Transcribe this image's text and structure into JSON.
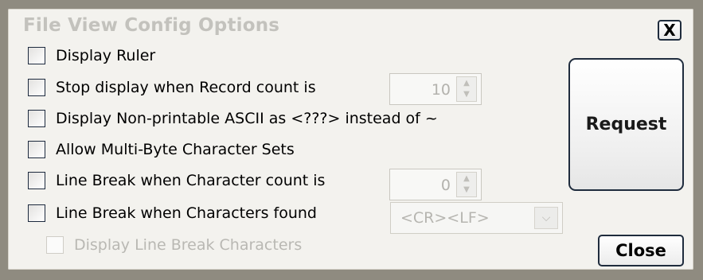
{
  "dialog": {
    "title": "File View Config Options",
    "close_x_label": "X"
  },
  "options": [
    {
      "label": "Display Ruler",
      "checked": false,
      "enabled": true
    },
    {
      "label": "Stop display when Record count is",
      "checked": false,
      "enabled": true
    },
    {
      "label": "Display Non-printable ASCII as <???> instead of ~",
      "checked": false,
      "enabled": true
    },
    {
      "label": "Allow Multi-Byte Character Sets",
      "checked": false,
      "enabled": true
    },
    {
      "label": "Line Break when Character count is",
      "checked": false,
      "enabled": true
    },
    {
      "label": "Line Break when Characters found",
      "checked": false,
      "enabled": true
    },
    {
      "label": "Display Line Break Characters",
      "checked": false,
      "enabled": false
    }
  ],
  "record_count_spinner": {
    "value": "10",
    "enabled": false
  },
  "char_count_spinner": {
    "value": "0",
    "enabled": false
  },
  "line_break_chars_dropdown": {
    "value": "<CR><LF>",
    "enabled": false
  },
  "buttons": {
    "request_label": "Request",
    "close_label": "Close"
  },
  "colors": {
    "frame": "#8f8b80",
    "dialog_background": "#f3f2ee",
    "button_border": "#1f2c3d",
    "disabled_text": "#b9b8b3"
  },
  "icons": {
    "spinner_up": "triangle-up-icon",
    "spinner_down": "triangle-down-icon",
    "dropdown": "chevron-down-icon"
  }
}
